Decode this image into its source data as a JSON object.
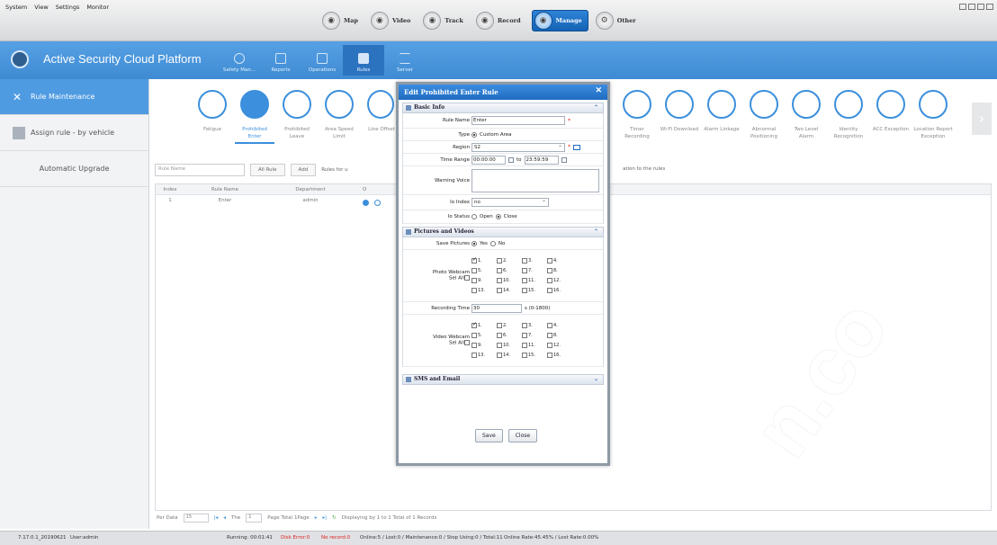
{
  "menu": [
    "System",
    "View",
    "Settings",
    "Monitor"
  ],
  "main_nav": [
    {
      "label": "Map",
      "icon": "map-icon"
    },
    {
      "label": "Video",
      "icon": "video-icon"
    },
    {
      "label": "Track",
      "icon": "track-icon"
    },
    {
      "label": "Record",
      "icon": "record-icon"
    },
    {
      "label": "Manage",
      "icon": "manage-icon",
      "active": true
    },
    {
      "label": "Other",
      "icon": "other-icon"
    }
  ],
  "header": {
    "title": "Active Security Cloud Platform",
    "tabs": [
      "Safety Man...",
      "Reports",
      "Operations",
      "Rules",
      "Server"
    ],
    "active_tab": "Rules"
  },
  "sidebar": [
    "Rule Maintenance",
    "Assign rule - by vehicle",
    "Automatic Upgrade"
  ],
  "rule_types": [
    "Fatigue",
    "Prohibited Enter",
    "Prohibited Leave",
    "Area Speed Limit",
    "Line Offset",
    "Timer Recording",
    "Wi-Fi Download",
    "Alarm Linkage",
    "Abnormal Positioning",
    "Two Level Alarm",
    "Identity Recognition",
    "ACC Exception",
    "Location Report Exception"
  ],
  "toolbar": {
    "search_placeholder": "Rule Name",
    "all_rule": "All Rule",
    "add": "Add",
    "rules_for": "Rules for u",
    "note": "ation to the rules"
  },
  "table": {
    "headers": [
      "Index",
      "Rule Name",
      "Department",
      "O"
    ],
    "rows": [
      {
        "index": "1",
        "rule_name": "Enter",
        "department": "admin"
      }
    ]
  },
  "pager": {
    "per_data_label": "Per Data",
    "per_data_value": "15",
    "the": "The",
    "page_value": "1",
    "page_total": "Page Total 1Page",
    "displaying": "Displaying by 1 to 1 Total of 1 Records"
  },
  "status": {
    "version": "7.17.0.1_20190621",
    "user": "User:admin",
    "running": "Running: 00:01:41",
    "disk_error": "Disk Error:0",
    "no_record": "No record:0",
    "stats": "Online:5 / Lost:0 / Maintenance:0 / Stop Using:0 / Total:11",
    "rates": "Online Rate:45.45% / Lost Rate:0.00%"
  },
  "dialog": {
    "title": "Edit   Prohibited Enter Rule",
    "basic_info": "Basic Info",
    "rule_name_label": "Rule Name",
    "rule_name_value": "Enter",
    "type_label": "Type",
    "type_value": "Custom Area",
    "region_label": "Region",
    "region_value": "S2",
    "time_range_label": "Time Range",
    "time_from": "00:00:00",
    "time_to_label": "to",
    "time_to": "23:59:59",
    "warning_voice_label": "Warning Voice",
    "io_index_label": "Io Index",
    "io_index_value": "no",
    "io_status_label": "Io Status",
    "io_open": "Open",
    "io_close": "Close",
    "pictures_videos": "Pictures and Videos",
    "save_pictures_label": "Save Pictures",
    "yes": "Yes",
    "no": "No",
    "photo_webcam_label": "Photo Webcam",
    "sel_all": "Sel All",
    "recording_time_label": "Recording Time",
    "recording_time_value": "30",
    "recording_time_hint": "s (0-1800)",
    "video_webcam_label": "Video Webcam",
    "sms_email": "SMS and Email",
    "save": "Save",
    "close": "Close",
    "photo_channels": [
      "1.",
      "2.",
      "3.",
      "4.",
      "5.",
      "6.",
      "7.",
      "8.",
      "9.",
      "10.",
      "11.",
      "12.",
      "13.",
      "14.",
      "15.",
      "16."
    ],
    "video_channels": [
      "1.",
      "2.",
      "3.",
      "4.",
      "5.",
      "6.",
      "7.",
      "8.",
      "9.",
      "10.",
      "11.",
      "12.",
      "13.",
      "14.",
      "15.",
      "16."
    ]
  },
  "watermark": "n.co"
}
